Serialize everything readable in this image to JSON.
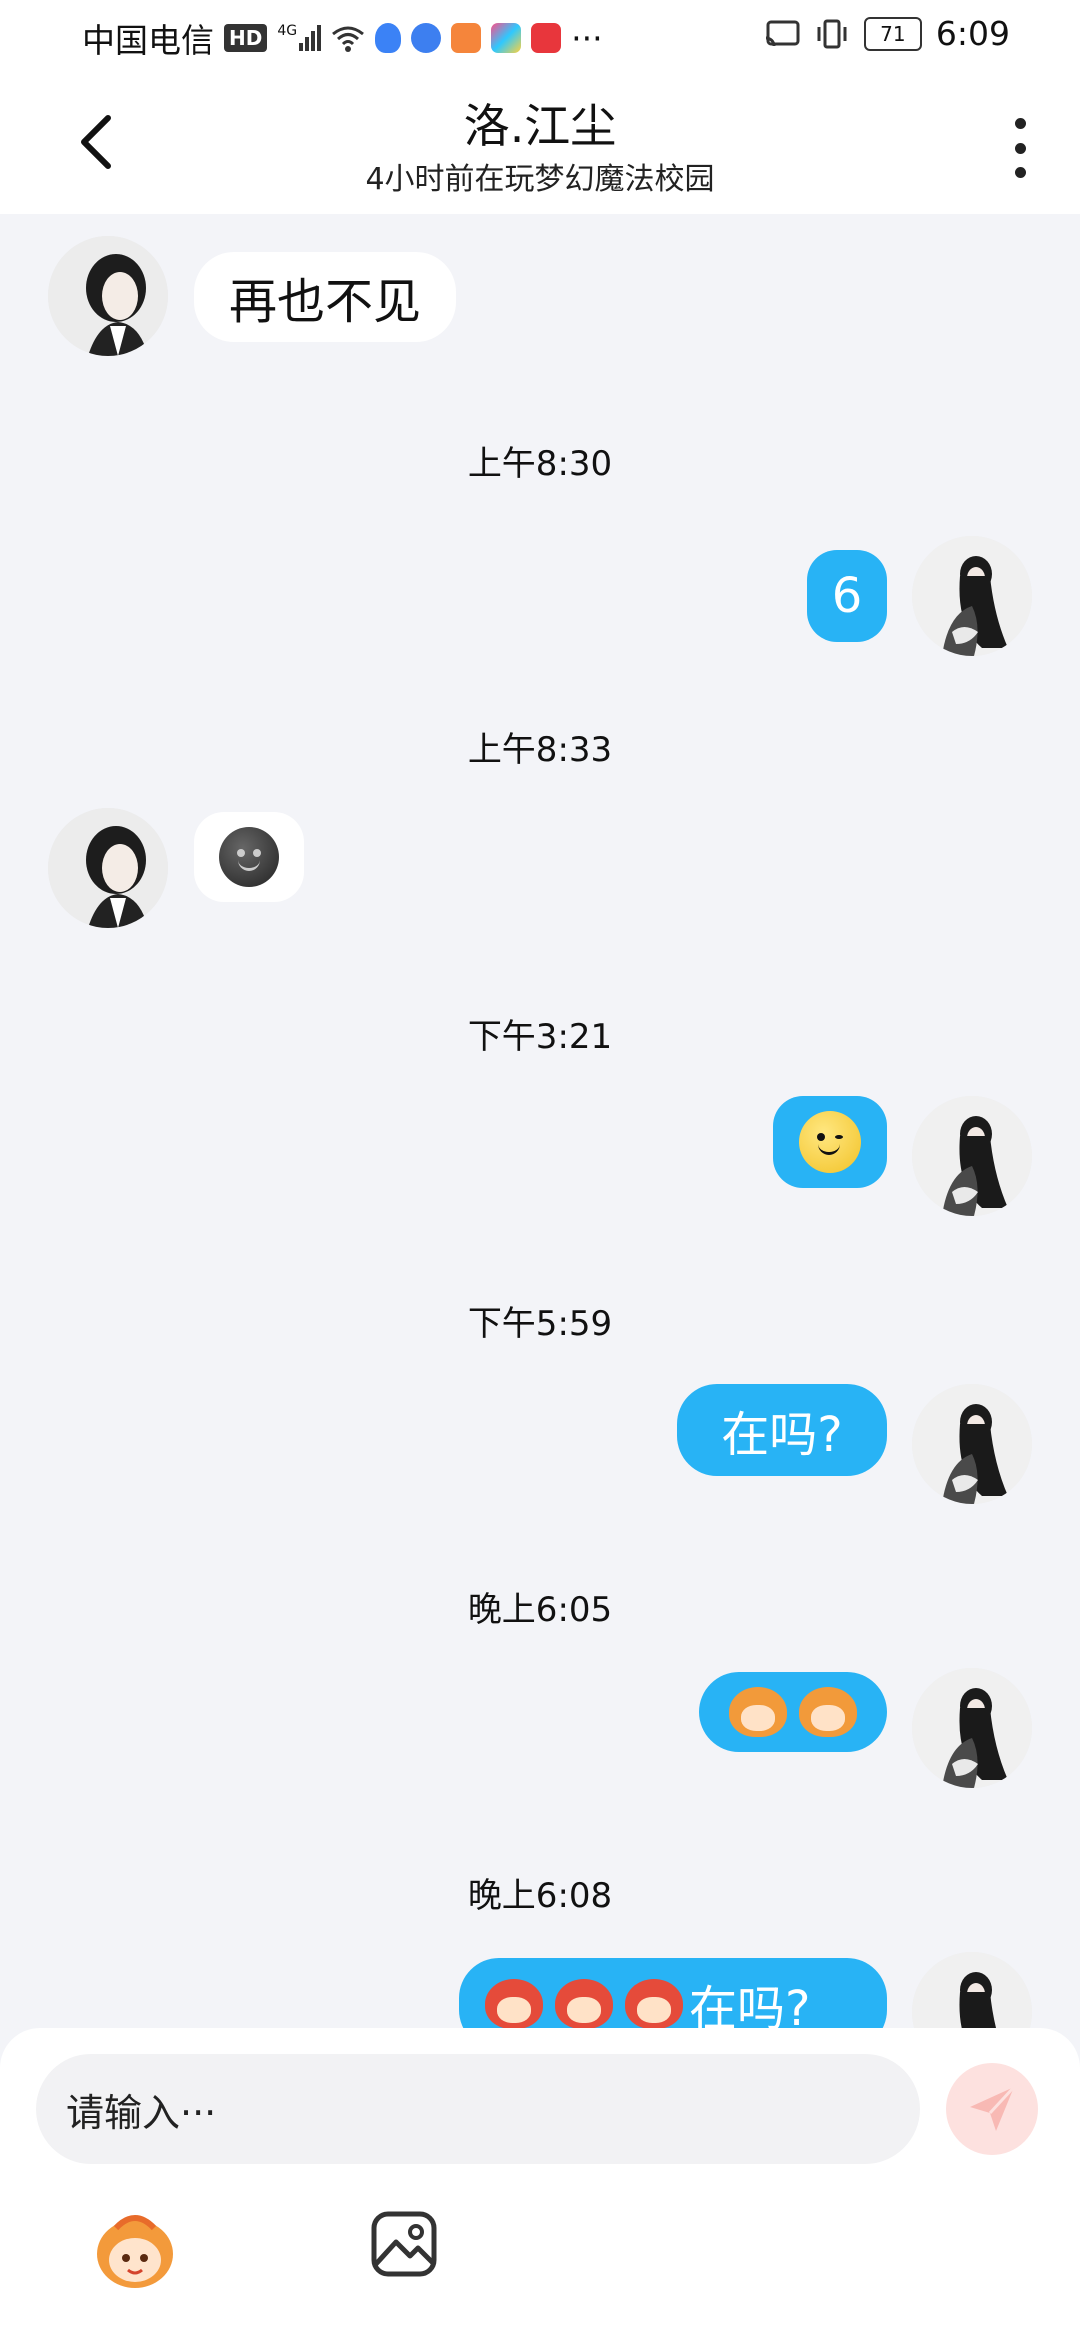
{
  "status_bar": {
    "carrier": "中国电信",
    "hd": "HD",
    "network": "4G",
    "more": "···",
    "battery": "71",
    "time": "6:09"
  },
  "header": {
    "title": "洛.江尘",
    "subtitle": "4小时前在玩梦幻魔法校园"
  },
  "messages": [
    {
      "side": "in",
      "text": "再也不见"
    },
    {
      "timestamp": "上午8:30"
    },
    {
      "side": "out",
      "text": "6"
    },
    {
      "timestamp": "上午8:33"
    },
    {
      "side": "in",
      "emoji": "dark-smile-face"
    },
    {
      "timestamp": "下午3:21"
    },
    {
      "side": "out",
      "emoji": "smirk-face"
    },
    {
      "timestamp": "下午5:59"
    },
    {
      "side": "out",
      "text": "在吗?"
    },
    {
      "timestamp": "晚上6:05"
    },
    {
      "side": "out",
      "emoji": "monkey-sticker"
    },
    {
      "timestamp": "晚上6:08"
    },
    {
      "side": "out",
      "text": "在吗?"
    }
  ],
  "input": {
    "placeholder": "请输入···"
  },
  "colors": {
    "bubble_out": "#28b3f5",
    "background": "#f3f4f8"
  }
}
